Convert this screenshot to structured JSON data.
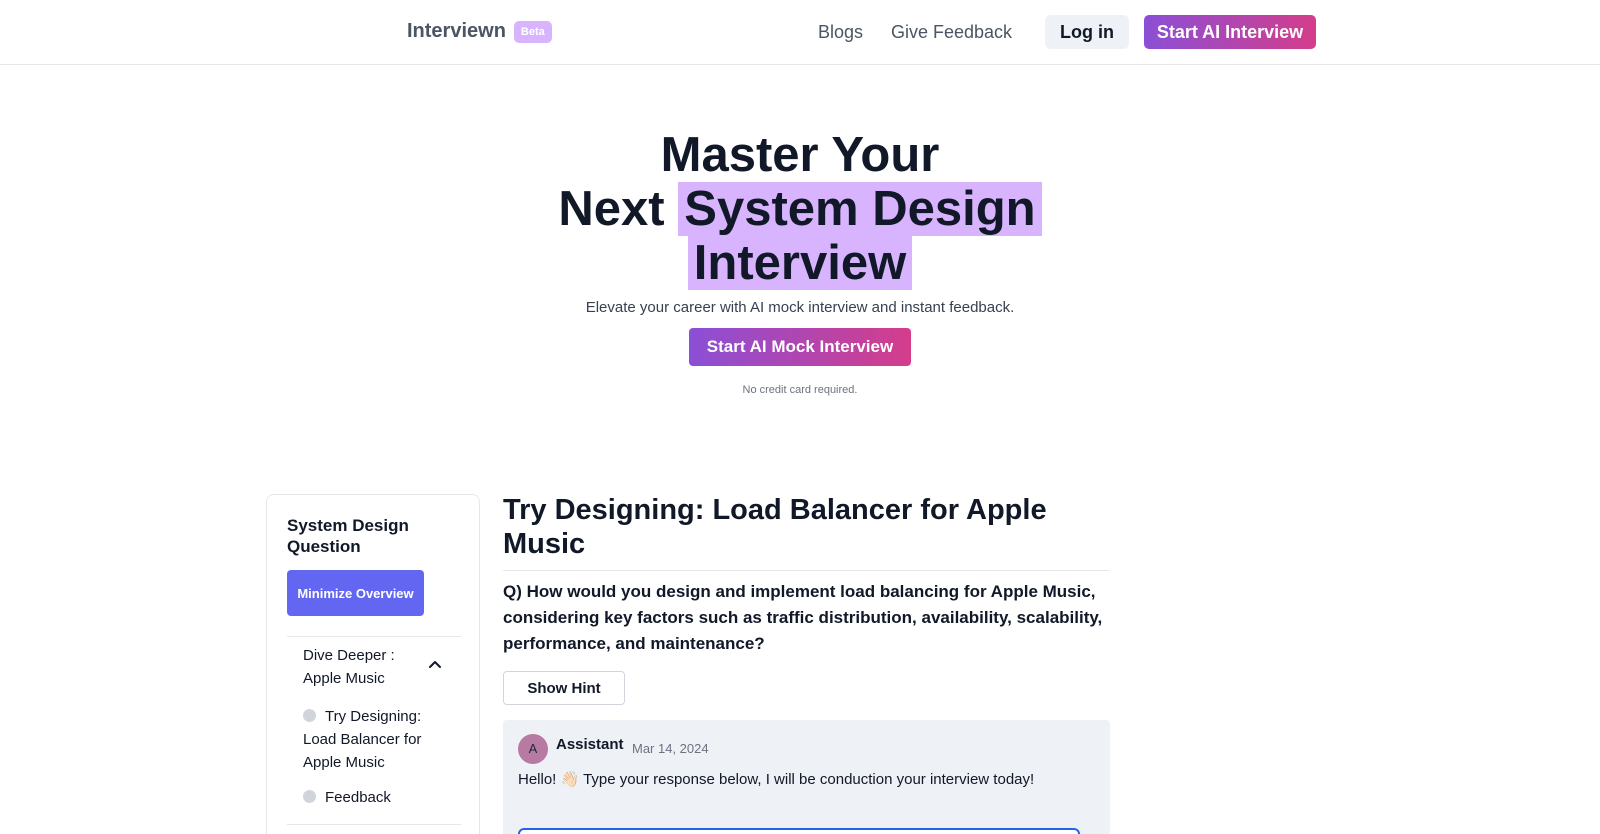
{
  "nav": {
    "brand": "Interviewn",
    "badge": "Beta",
    "links": [
      "Blogs",
      "Give Feedback"
    ],
    "login_label": "Log in",
    "start_label": "Start AI Interview"
  },
  "hero": {
    "title_line1": "Master Your",
    "title_next": "Next",
    "title_highlight1": "System Design",
    "title_highlight2": "Interview",
    "subtitle": "Elevate your career with AI mock interview and instant feedback.",
    "cta_label": "Start AI Mock Interview",
    "note": "No credit card required."
  },
  "sidebar": {
    "title": "System Design Question",
    "minimize_label": "Minimize Overview",
    "section_label": "Dive Deeper : Apple Music",
    "items": [
      "Try Designing: Load Balancer for Apple Music",
      "Feedback"
    ]
  },
  "main": {
    "title": "Try Designing: Load Balancer for Apple Music",
    "question": "Q) How would you design and implement load balancing for Apple Music, considering key factors such as traffic distribution, availability, scalability, performance, and maintenance?",
    "hint_label": "Show Hint"
  },
  "chat": {
    "avatar_letter": "A",
    "sender": "Assistant",
    "date": "Mar 14, 2024",
    "message": "Hello! 👋🏻 Type your response below, I will be conduction your interview today!"
  },
  "icons": {
    "chevron": "chevron-up-icon"
  },
  "colors": {
    "accent_gradient_start": "#8b4fd6",
    "accent_gradient_end": "#d43d8a",
    "highlight": "#d8b4fe",
    "primary_button": "#6366f1"
  }
}
